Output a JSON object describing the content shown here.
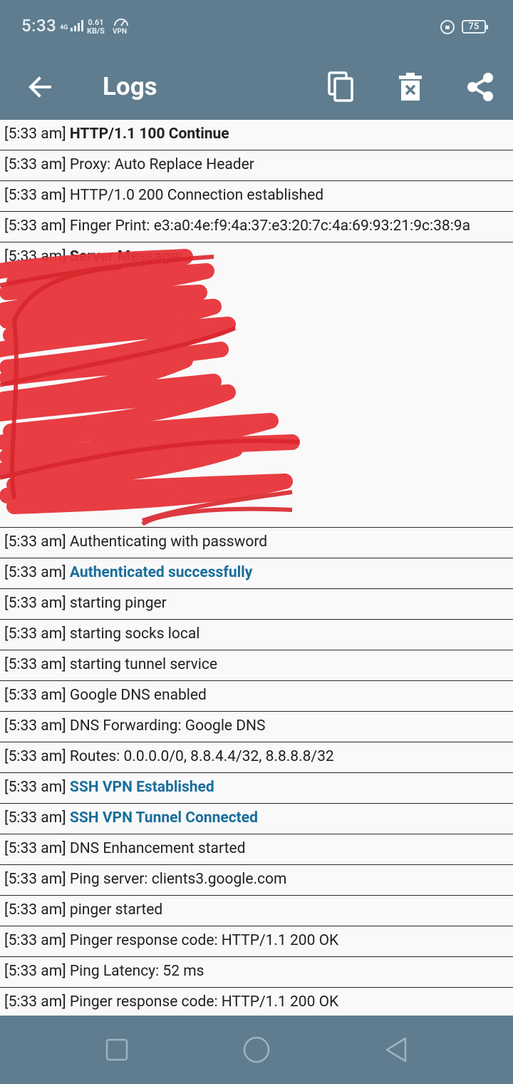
{
  "status_bar": {
    "time": "5:33",
    "network": "4G",
    "speed_value": "0.61",
    "speed_unit": "KB/S",
    "vpn": "VPN",
    "battery": "75"
  },
  "app_bar": {
    "title": "Logs",
    "icons": [
      "back-arrow-icon",
      "copy-icon",
      "delete-icon",
      "share-icon"
    ]
  },
  "logs": [
    {
      "time": "[5:33 am]",
      "message": "HTTP/1.1 100 Continue",
      "style": "bold"
    },
    {
      "time": "[5:33 am]",
      "message": "Proxy: Auto Replace Header",
      "style": "normal"
    },
    {
      "time": "[5:33 am]",
      "message": "HTTP/1.0 200 Connection established",
      "style": "normal"
    },
    {
      "time": "[5:33 am]",
      "message": "Finger Print: e3:a0:4e:f9:4a:37:e3:20:7c:4a:69:93:21:9c:38:9a",
      "style": "normal"
    },
    {
      "time": "[5:33 am]",
      "message": "Server Message:",
      "style": "bold",
      "redacted_body": true
    },
    {
      "time": "[5:33 am]",
      "message": "Authenticating with password",
      "style": "normal"
    },
    {
      "time": "[5:33 am]",
      "message": "Authenticated successfully",
      "style": "blue"
    },
    {
      "time": "[5:33 am]",
      "message": "starting pinger",
      "style": "normal"
    },
    {
      "time": "[5:33 am]",
      "message": "starting socks local",
      "style": "normal"
    },
    {
      "time": "[5:33 am]",
      "message": "starting tunnel service",
      "style": "normal"
    },
    {
      "time": "[5:33 am]",
      "message": "Google DNS enabled",
      "style": "normal"
    },
    {
      "time": "[5:33 am]",
      "message": "DNS Forwarding: Google DNS",
      "style": "normal"
    },
    {
      "time": "[5:33 am]",
      "message": "Routes: 0.0.0.0/0, 8.8.4.4/32, 8.8.8.8/32",
      "style": "normal"
    },
    {
      "time": "[5:33 am]",
      "message": "SSH VPN Established",
      "style": "blue"
    },
    {
      "time": "[5:33 am]",
      "message": "SSH VPN Tunnel Connected",
      "style": "blue"
    },
    {
      "time": "[5:33 am]",
      "message": "DNS Enhancement started",
      "style": "normal"
    },
    {
      "time": "[5:33 am]",
      "message": "Ping server: clients3.google.com",
      "style": "normal"
    },
    {
      "time": "[5:33 am]",
      "message": "pinger started",
      "style": "normal"
    },
    {
      "time": "[5:33 am]",
      "message": "Pinger response code: HTTP/1.1 200 OK",
      "style": "normal"
    },
    {
      "time": "[5:33 am]",
      "message": "Ping Latency: 52 ms",
      "style": "normal"
    },
    {
      "time": "[5:33 am]",
      "message": "Pinger response code: HTTP/1.1 200 OK",
      "style": "normal"
    }
  ],
  "colors": {
    "toolbar": "#5f7d8f",
    "highlight_blue": "#1a6e9b",
    "redaction": "#e8333a"
  },
  "nav_bar": {
    "buttons": [
      "recents-square-icon",
      "home-circle-icon",
      "back-triangle-icon"
    ]
  }
}
